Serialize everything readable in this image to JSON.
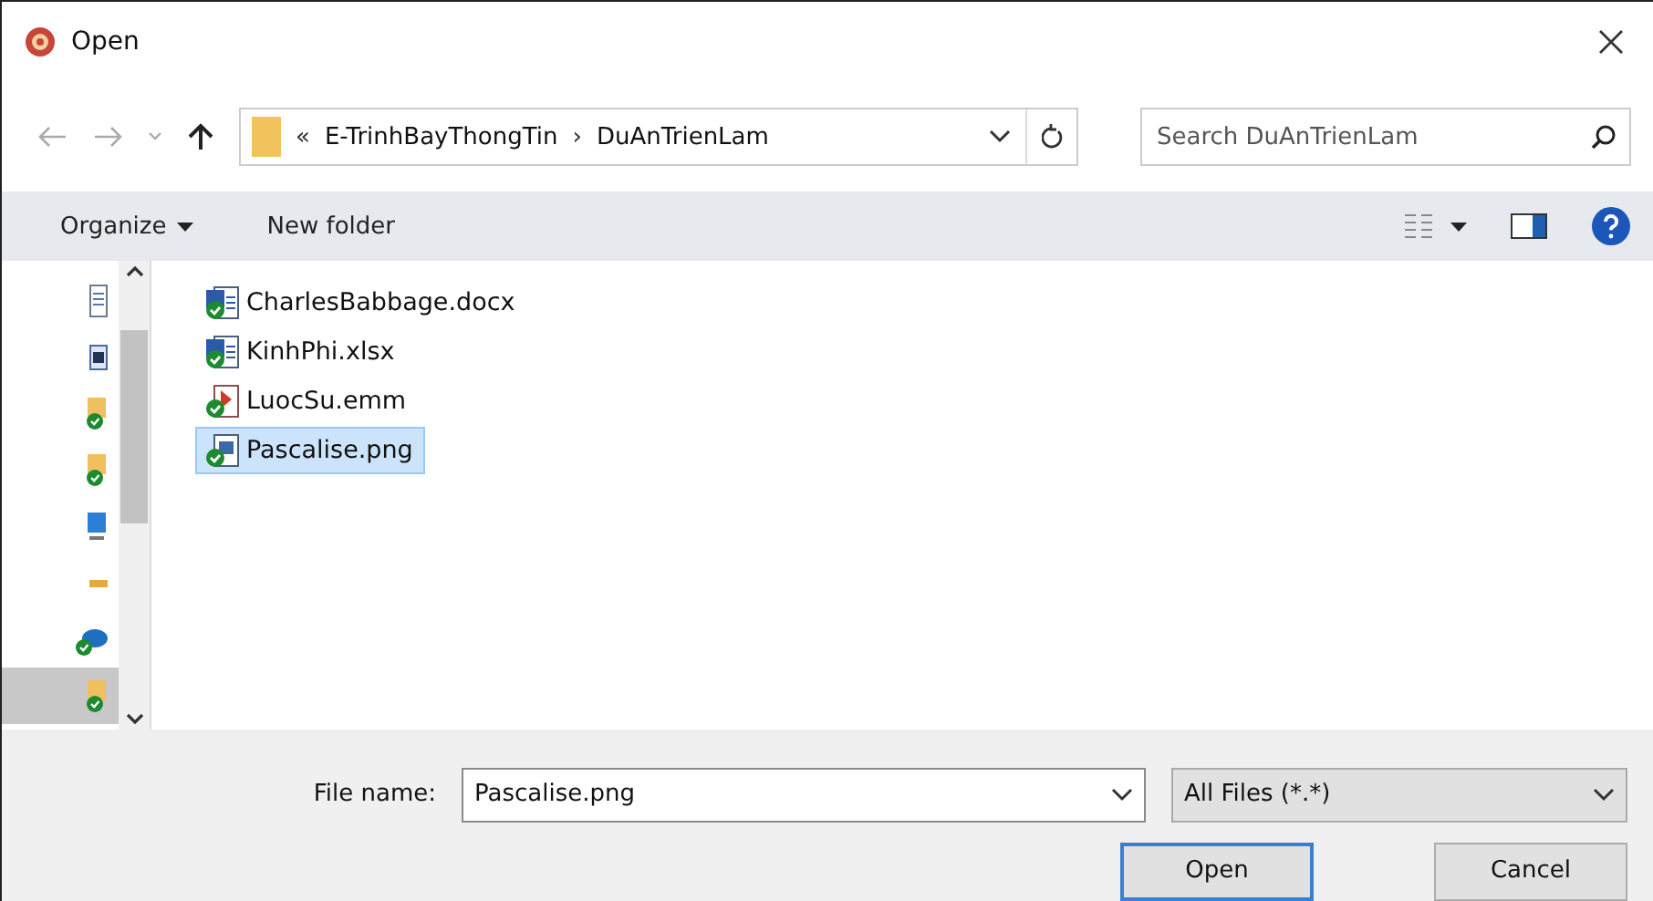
{
  "window": {
    "title": "Open"
  },
  "address": {
    "prefix": "«",
    "path": [
      "E-TrinhBayThongTin",
      "DuAnTrienLam"
    ],
    "separator": "›"
  },
  "search": {
    "placeholder": "Search DuAnTrienLam"
  },
  "toolbar": {
    "organize": "Organize",
    "new_folder": "New folder"
  },
  "nav_items": [
    {
      "kind": "document",
      "selected": false
    },
    {
      "kind": "picture",
      "selected": false
    },
    {
      "kind": "folder",
      "selected": false
    },
    {
      "kind": "folder",
      "selected": false
    },
    {
      "kind": "computer",
      "selected": false
    },
    {
      "kind": "drive",
      "selected": false
    },
    {
      "kind": "cloud",
      "selected": false
    },
    {
      "kind": "folder",
      "selected": true
    }
  ],
  "files": [
    {
      "name": "CharlesBabbage.docx",
      "kind": "doc",
      "selected": false
    },
    {
      "name": "KinhPhi.xlsx",
      "kind": "doc",
      "selected": false
    },
    {
      "name": "LuocSu.emm",
      "kind": "media",
      "selected": false
    },
    {
      "name": "Pascalise.png",
      "kind": "image",
      "selected": true
    }
  ],
  "file_name": {
    "label": "File name:",
    "value": "Pascalise.png"
  },
  "file_type": {
    "value": "All Files (*.*)"
  },
  "buttons": [
    {
      "label": "Open",
      "kind": "primary"
    },
    {
      "label": "Cancel",
      "kind": "normal"
    }
  ]
}
